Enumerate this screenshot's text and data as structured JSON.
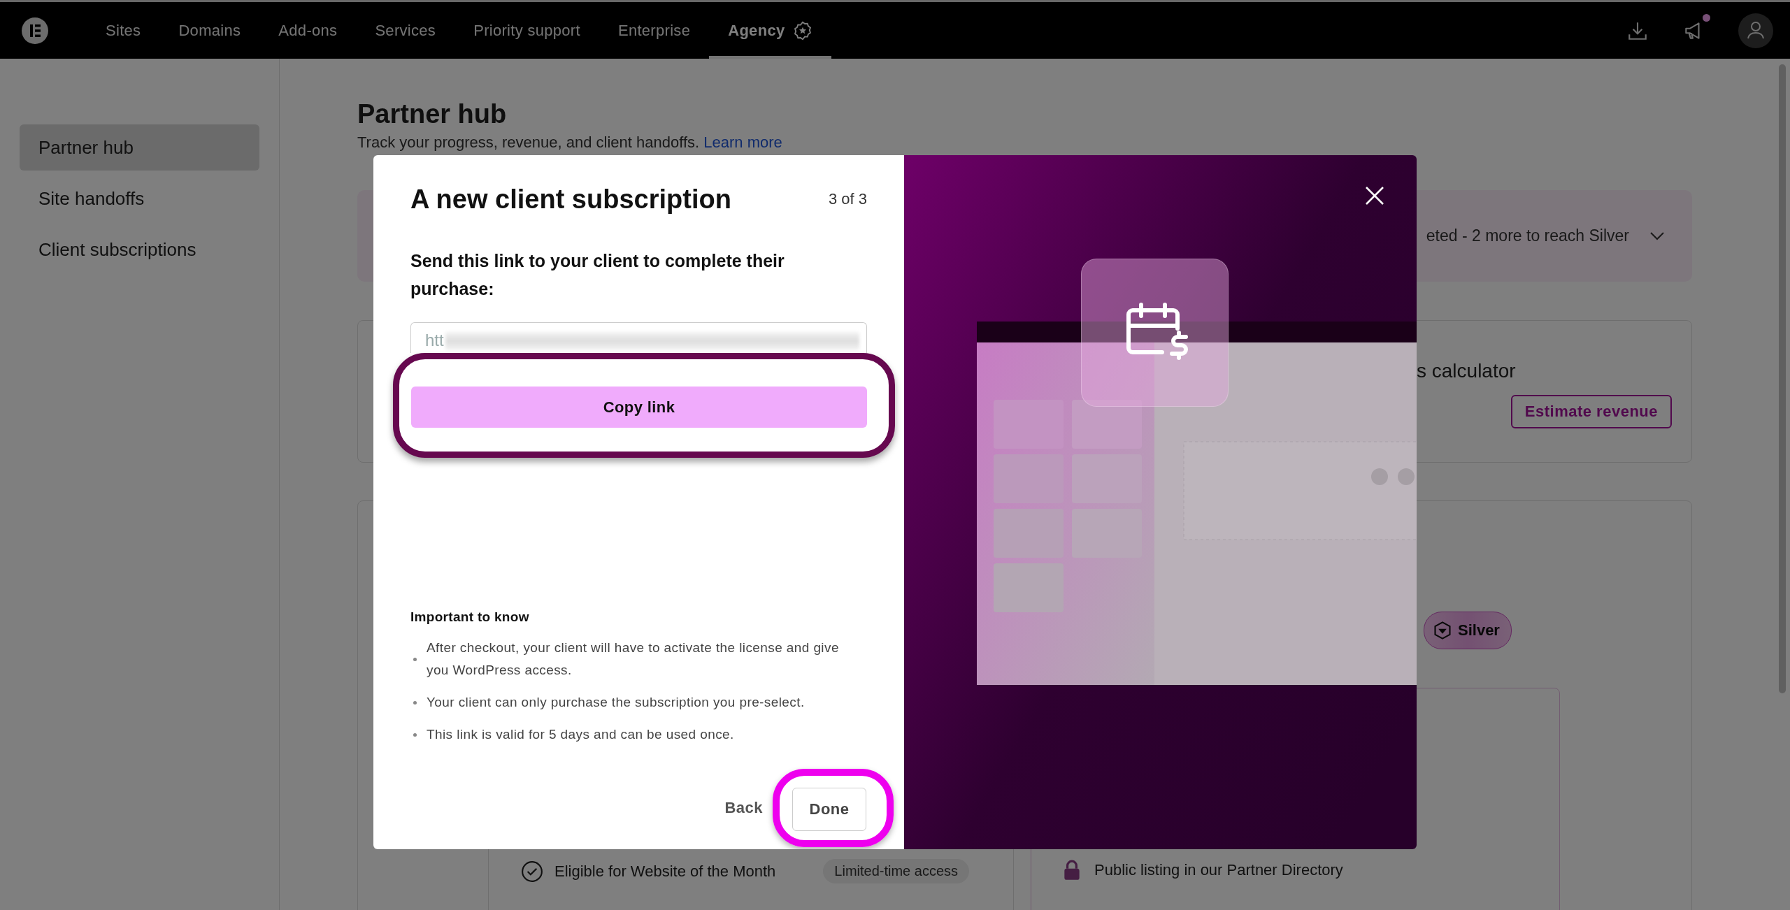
{
  "top_nav": {
    "items": [
      {
        "label": "Sites",
        "kind": "text",
        "selected": false
      },
      {
        "label": "Domains",
        "kind": "text",
        "selected": false
      },
      {
        "label": "Add-ons",
        "kind": "text",
        "selected": false
      },
      {
        "label": "Services",
        "kind": "text",
        "selected": false
      },
      {
        "label": "Priority support",
        "kind": "text",
        "selected": false
      },
      {
        "label": "Enterprise",
        "kind": "text",
        "selected": false
      },
      {
        "label": "Agency",
        "kind": "badge",
        "selected": true
      }
    ],
    "notification_dot": true
  },
  "sidebar": {
    "items": [
      {
        "label": "Partner hub",
        "selected": true
      },
      {
        "label": "Site handoffs",
        "selected": false
      },
      {
        "label": "Client subscriptions",
        "selected": false
      }
    ]
  },
  "page": {
    "title": "Partner hub",
    "subtitle": "Track your progress, revenue, and client handoffs.",
    "learn_more": "Learn more",
    "progress_banner": {
      "text": "eted - 2 more to reach Silver"
    },
    "calculator": {
      "title": "s calculator",
      "button": "Estimate revenue"
    },
    "tier_badge": "Silver",
    "benefits": [
      {
        "text": "Eligible for Website of the Month",
        "tag": "Limited-time access"
      }
    ],
    "locked_benefits": [
      {
        "text": "Public listing in our Partner Directory"
      }
    ]
  },
  "modal": {
    "title": "A new client subscription",
    "step": "3 of 3",
    "instruction": "Send this link to your client to complete their purchase:",
    "link_field": {
      "value": "htt"
    },
    "copy_button": "Copy link",
    "notes_heading": "Important to know",
    "notes": [
      "After checkout, your client will have to activate the license and give you WordPress access.",
      "Your client can only purchase the subscription you pre-select.",
      "This link is valid for 5 days and can be used once."
    ],
    "back": "Back",
    "done": "Done"
  },
  "highlights": [
    {
      "color": "#66084f"
    },
    {
      "color": "#ee00ee"
    }
  ]
}
